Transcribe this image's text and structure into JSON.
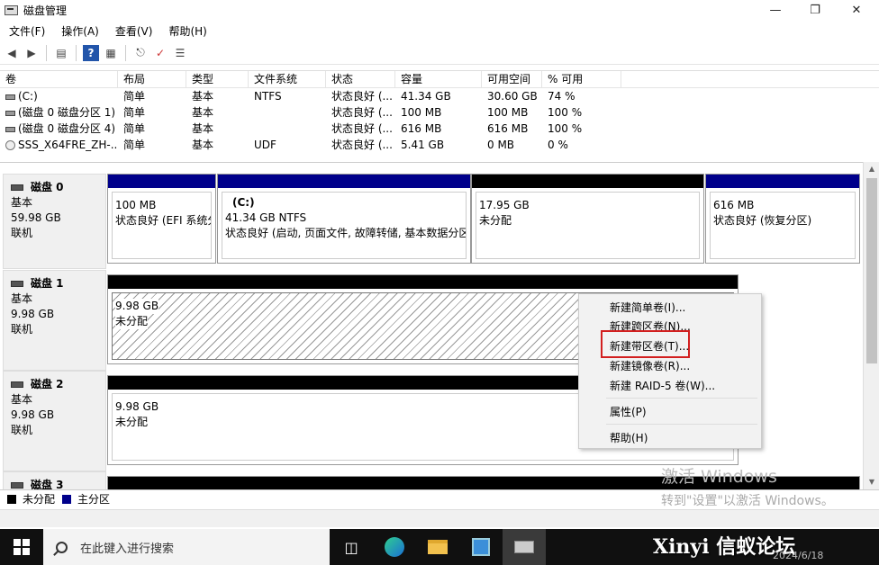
{
  "window": {
    "title": "磁盘管理",
    "controls": [
      "—",
      "❐",
      "✕"
    ]
  },
  "menu": [
    "文件(F)",
    "操作(A)",
    "查看(V)",
    "帮助(H)"
  ],
  "volume_table": {
    "headers": [
      "卷",
      "布局",
      "类型",
      "文件系统",
      "状态",
      "容量",
      "可用空间",
      "% 可用"
    ],
    "rows": [
      [
        "(C:)",
        "简单",
        "基本",
        "NTFS",
        "状态良好 (...",
        "41.34 GB",
        "30.60 GB",
        "74 %"
      ],
      [
        "(磁盘 0 磁盘分区 1)",
        "简单",
        "基本",
        "",
        "状态良好 (...",
        "100 MB",
        "100 MB",
        "100 %"
      ],
      [
        "(磁盘 0 磁盘分区 4)",
        "简单",
        "基本",
        "",
        "状态良好 (...",
        "616 MB",
        "616 MB",
        "100 %"
      ],
      [
        "SSS_X64FRE_ZH-...",
        "简单",
        "基本",
        "UDF",
        "状态良好 (...",
        "5.41 GB",
        "0 MB",
        "0 %"
      ]
    ]
  },
  "disks": [
    {
      "name": "磁盘 0",
      "type": "基本",
      "size": "59.98 GB",
      "status": "联机",
      "partitions": [
        {
          "label": "",
          "size": "100 MB",
          "status": "状态良好 (EFI 系统分",
          "kind": "primary"
        },
        {
          "label": "(C:)",
          "size": "41.34 GB NTFS",
          "status": "状态良好 (启动, 页面文件, 故障转储, 基本数据分区",
          "kind": "primary"
        },
        {
          "label": "",
          "size": "17.95 GB",
          "status": "未分配",
          "kind": "unallocated"
        },
        {
          "label": "",
          "size": "616 MB",
          "status": "状态良好 (恢复分区)",
          "kind": "primary"
        }
      ]
    },
    {
      "name": "磁盘 1",
      "type": "基本",
      "size": "9.98 GB",
      "status": "联机",
      "partitions": [
        {
          "label": "",
          "size": "9.98 GB",
          "status": "未分配",
          "kind": "unallocated-selected"
        }
      ]
    },
    {
      "name": "磁盘 2",
      "type": "基本",
      "size": "9.98 GB",
      "status": "联机",
      "partitions": [
        {
          "label": "",
          "size": "9.98 GB",
          "status": "未分配",
          "kind": "unallocated"
        }
      ]
    },
    {
      "name": "磁盘 3",
      "type": "",
      "size": "",
      "status": "",
      "partitions": []
    }
  ],
  "legend": {
    "unallocated": "未分配",
    "primary": "主分区",
    "unallocated_color": "#000000",
    "primary_color": "#00008b"
  },
  "context_menu": {
    "items": [
      "新建简单卷(I)...",
      "新建跨区卷(N)...",
      "新建带区卷(T)...",
      "新建镜像卷(R)...",
      "新建 RAID-5 卷(W)...",
      "属性(P)",
      "帮助(H)"
    ],
    "highlighted": "新建带区卷(T)..."
  },
  "watermark": {
    "line1": "激活 Windows",
    "line2": "转到\"设置\"以激活 Windows。"
  },
  "taskbar": {
    "search_placeholder": "在此键入进行搜索",
    "forum_text": "Xinyi 信蚁论坛",
    "date": "2024/6/18"
  }
}
